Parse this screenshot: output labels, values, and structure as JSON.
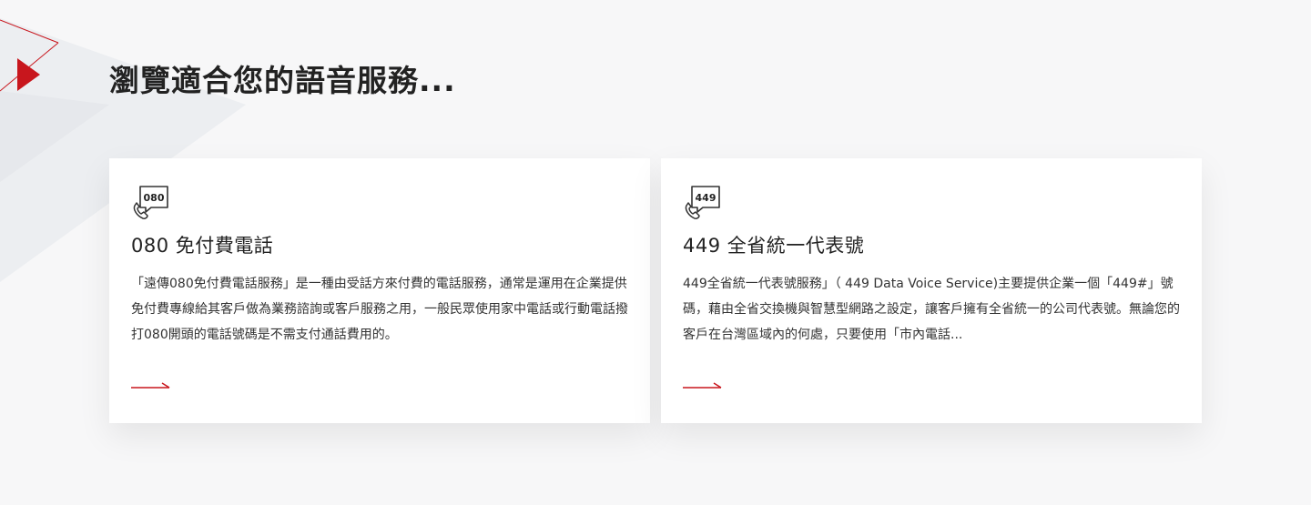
{
  "page": {
    "title": "瀏覽適合您的語音服務..."
  },
  "colors": {
    "accent": "#c8161d",
    "card_bg": "#ffffff",
    "page_bg": "#f7f7f8"
  },
  "cards": [
    {
      "icon": "phone-080-icon",
      "icon_text": "080",
      "title": "080 免付費電話",
      "description": "「遠傳080免付費電話服務」是一種由受話方來付費的電話服務，通常是運用在企業提供免付費專線給其客戶做為業務諮詢或客戶服務之用，一般民眾使用家中電話或行動電話撥打080開頭的電話號碼是不需支付通話費用的。",
      "link_icon": "arrow-right-icon"
    },
    {
      "icon": "phone-449-icon",
      "icon_text": "449",
      "title": "449 全省統一代表號",
      "description": "449全省統一代表號服務」（ 449 Data Voice Service)主要提供企業一個「449#」號碼，藉由全省交換機與智慧型網路之設定，讓客戶擁有全省統一的公司代表號。無論您的客戶在台灣區域內的何處，只要使用「市內電話...",
      "link_icon": "arrow-right-icon"
    }
  ]
}
